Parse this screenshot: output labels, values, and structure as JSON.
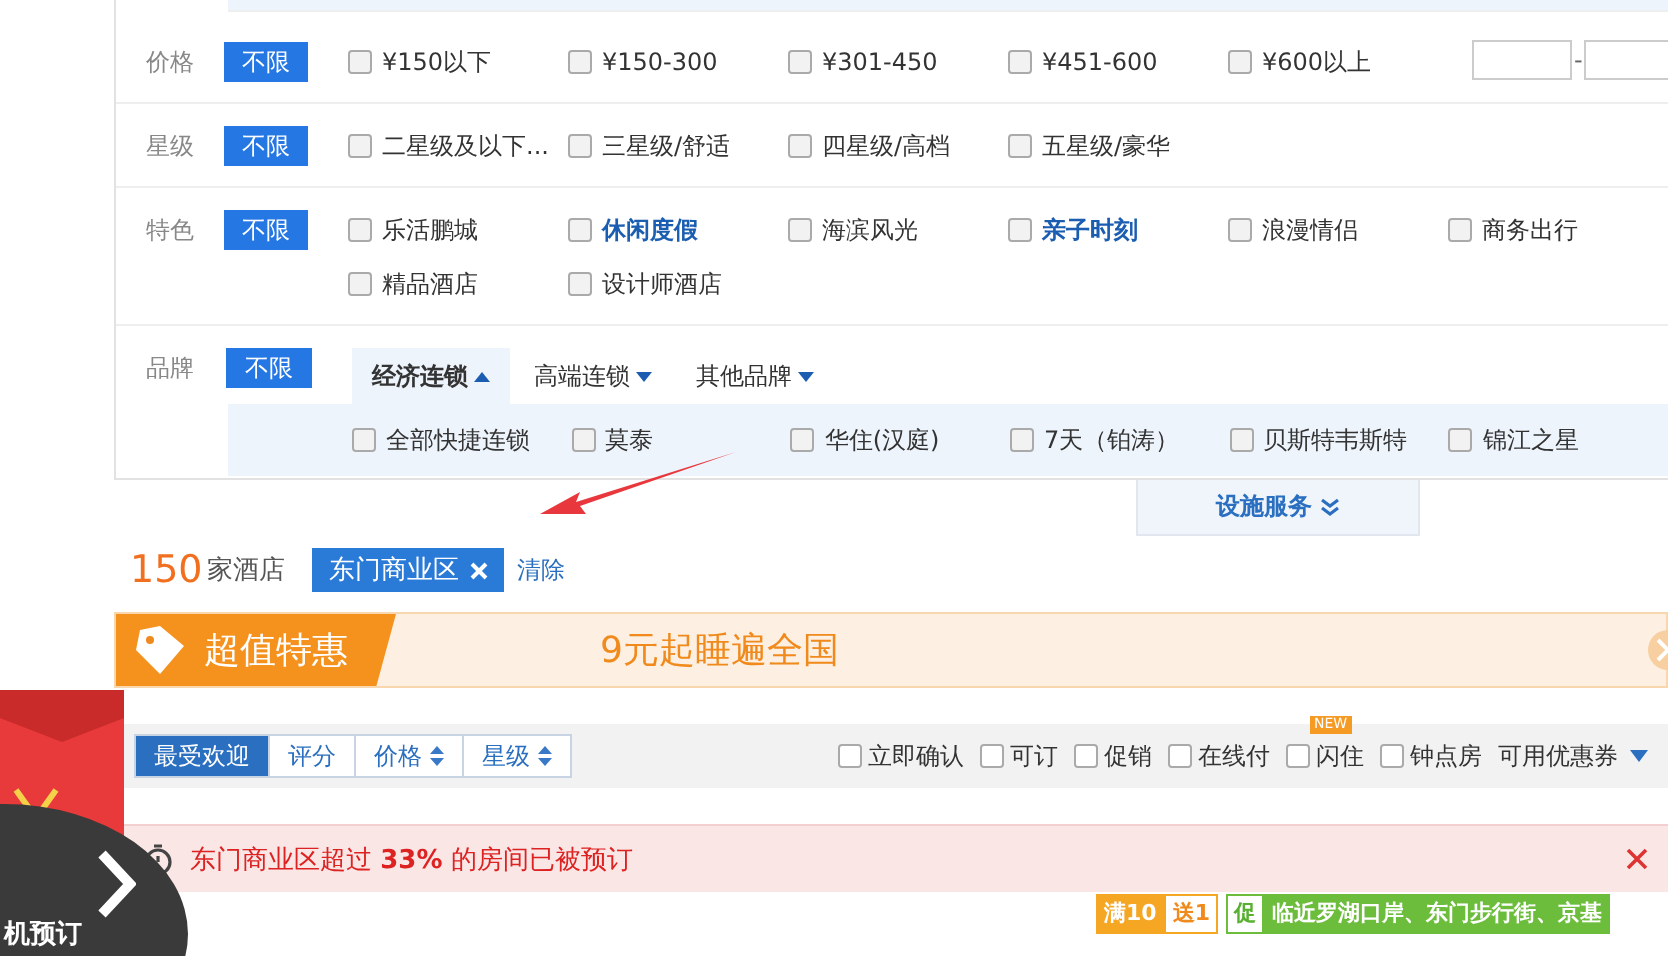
{
  "filters": [
    {
      "label": "价格",
      "all": "不限",
      "range": {
        "separator": "-"
      },
      "options": [
        {
          "text": "¥150以下",
          "highlighted": false
        },
        {
          "text": "¥150-300",
          "highlighted": false
        },
        {
          "text": "¥301-450",
          "highlighted": false
        },
        {
          "text": "¥451-600",
          "highlighted": false
        },
        {
          "text": "¥600以上",
          "highlighted": false
        }
      ]
    },
    {
      "label": "星级",
      "all": "不限",
      "options": [
        {
          "text": "二星级及以下...",
          "highlighted": false
        },
        {
          "text": "三星级/舒适",
          "highlighted": false
        },
        {
          "text": "四星级/高档",
          "highlighted": false
        },
        {
          "text": "五星级/豪华",
          "highlighted": false
        }
      ]
    },
    {
      "label": "特色",
      "all": "不限",
      "options": [
        {
          "text": "乐活鹏城",
          "highlighted": false
        },
        {
          "text": "休闲度假",
          "highlighted": true
        },
        {
          "text": "海滨风光",
          "highlighted": false
        },
        {
          "text": "亲子时刻",
          "highlighted": true
        },
        {
          "text": "浪漫情侣",
          "highlighted": false
        },
        {
          "text": "商务出行",
          "highlighted": false
        },
        {
          "text": "精品酒店",
          "highlighted": false
        },
        {
          "text": "设计师酒店",
          "highlighted": false
        }
      ]
    }
  ],
  "brand": {
    "label": "品牌",
    "all": "不限",
    "tabs": [
      {
        "text": "经济连锁",
        "selected": true
      },
      {
        "text": "高端连锁",
        "selected": false
      },
      {
        "text": "其他品牌",
        "selected": false
      }
    ],
    "options": [
      "全部快捷连锁",
      "莫泰",
      "华住(汉庭)",
      "7天（铂涛）",
      "贝斯特韦斯特",
      "锦江之星"
    ]
  },
  "more_tab": "设施服务",
  "results": {
    "count": "150",
    "unit": "家酒店",
    "tag": "东门商业区",
    "clear": "清除"
  },
  "banner": {
    "title": "超值特惠",
    "slogan": "9元起睡遍全国"
  },
  "sort_tabs": [
    {
      "text": "最受欢迎",
      "selected": true,
      "sortable": false
    },
    {
      "text": "评分",
      "selected": false,
      "sortable": false
    },
    {
      "text": "价格",
      "selected": false,
      "sortable": true
    },
    {
      "text": "星级",
      "selected": false,
      "sortable": true
    }
  ],
  "quick_filters": [
    {
      "text": "立即确认",
      "checked": false
    },
    {
      "text": "可订",
      "checked": false
    },
    {
      "text": "促销",
      "checked": false
    },
    {
      "text": "在线付",
      "checked": false
    },
    {
      "text": "闪住",
      "checked": false,
      "badge": "NEW"
    },
    {
      "text": "钟点房",
      "checked": false
    }
  ],
  "coupon": "可用优惠券",
  "alert": "东门商业区超过 **33%** 的房间已被预订",
  "promo": {
    "full": "满10",
    "gift": "送1",
    "promo_mark": "促",
    "promo_text": "临近罗湖口岸、东门步行街、京基"
  },
  "float_widget": {
    "label": "机预订"
  }
}
